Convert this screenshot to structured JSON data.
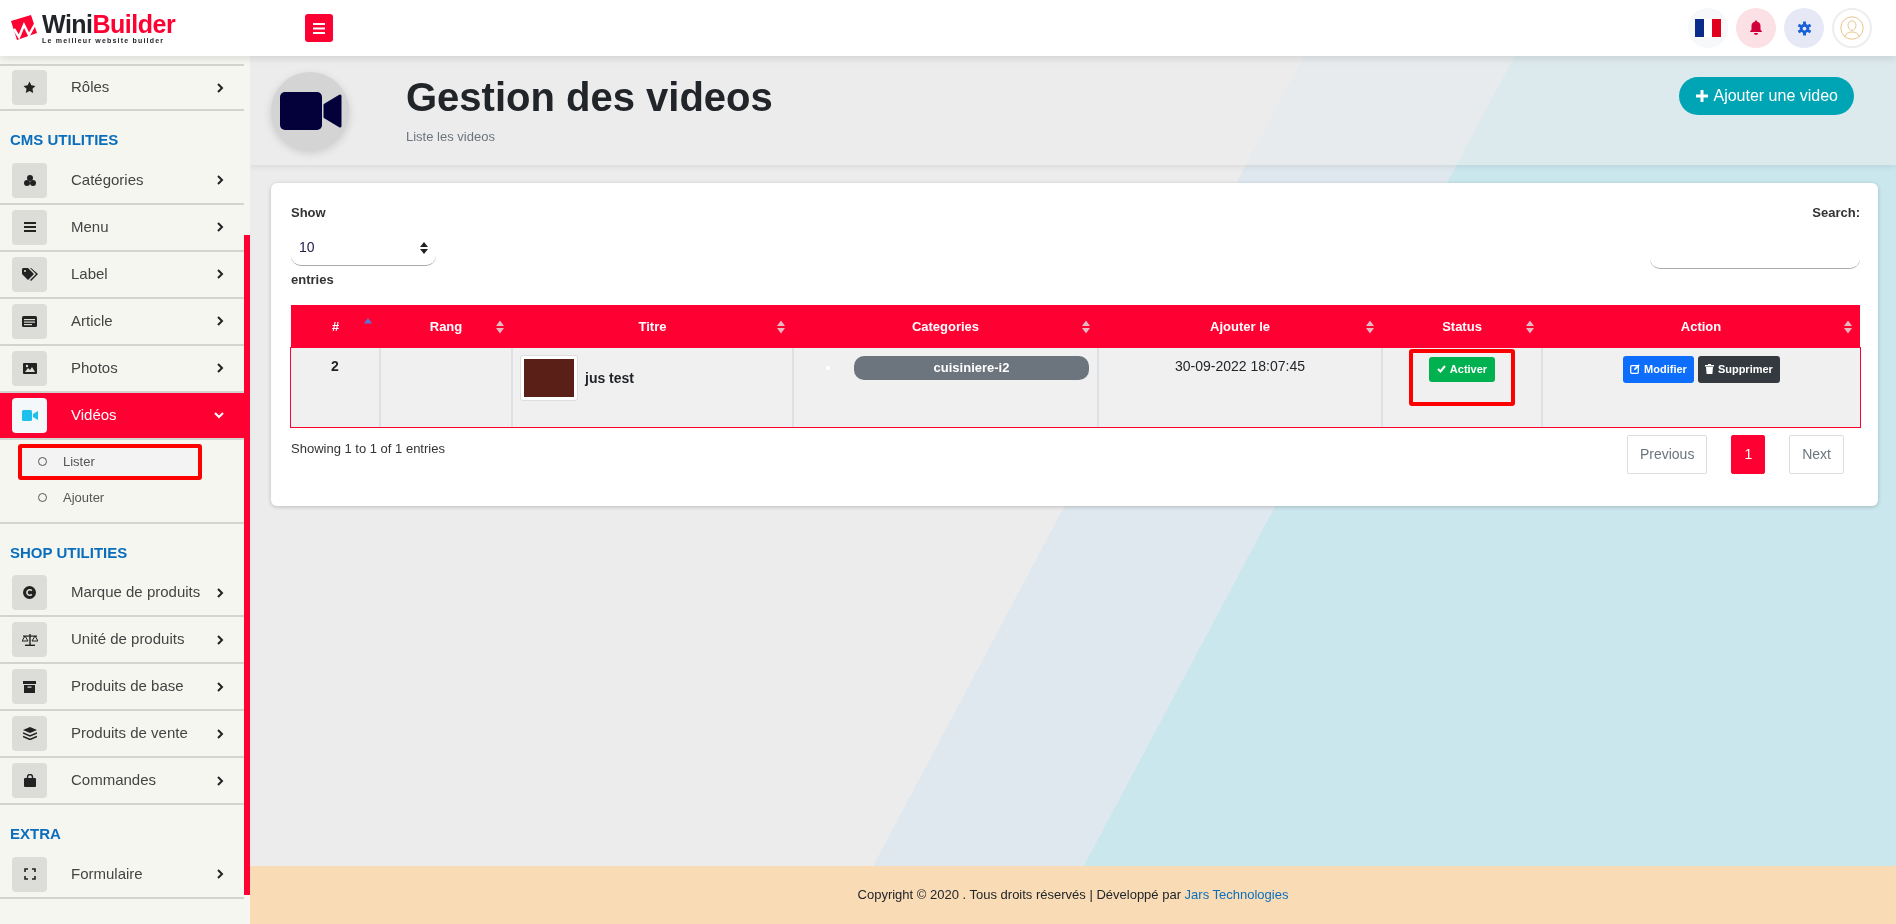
{
  "header": {
    "logo": {
      "primary": "Wini",
      "accent": "Builder",
      "tagline": "Le meilleur website builder"
    }
  },
  "sidebar": {
    "sections": [
      {
        "items": [
          {
            "label": "Rôles",
            "selected": false,
            "expanded": false
          }
        ]
      },
      {
        "heading": "CMS UTILITIES",
        "items": [
          {
            "label": "Catégories",
            "selected": false,
            "expanded": false
          },
          {
            "label": "Menu",
            "selected": false,
            "expanded": false
          },
          {
            "label": "Label",
            "selected": false,
            "expanded": false
          },
          {
            "label": "Article",
            "selected": false,
            "expanded": false
          },
          {
            "label": "Photos",
            "selected": false,
            "expanded": false
          },
          {
            "label": "Vidéos",
            "selected": true,
            "expanded": true,
            "children": [
              {
                "label": "Lister",
                "annotated": true
              },
              {
                "label": "Ajouter",
                "annotated": false
              }
            ]
          }
        ]
      },
      {
        "heading": "SHOP UTILITIES",
        "items": [
          {
            "label": "Marque de produits",
            "selected": false,
            "expanded": false
          },
          {
            "label": "Unité de produits",
            "selected": false,
            "expanded": false
          },
          {
            "label": "Produits de base",
            "selected": false,
            "expanded": false
          },
          {
            "label": "Produits de vente",
            "selected": false,
            "expanded": false
          },
          {
            "label": "Commandes",
            "selected": false,
            "expanded": false
          }
        ]
      },
      {
        "heading": "EXTRA",
        "items": [
          {
            "label": "Formulaire",
            "selected": false,
            "expanded": false
          }
        ]
      }
    ]
  },
  "page_header": {
    "title": "Gestion des videos",
    "subtitle": "Liste les videos",
    "add_button": "Ajouter une video"
  },
  "table_controls": {
    "show_label": "Show",
    "page_length": "10",
    "entries_label": "entries",
    "search_label": "Search:"
  },
  "table": {
    "columns": [
      {
        "label": "#",
        "sorted": true
      },
      {
        "label": "Rang",
        "sorted": false
      },
      {
        "label": "Titre",
        "sorted": false
      },
      {
        "label": "Categories",
        "sorted": false
      },
      {
        "label": "Ajouter le",
        "sorted": false
      },
      {
        "label": "Status",
        "sorted": false
      },
      {
        "label": "Action",
        "sorted": false
      }
    ],
    "rows": [
      {
        "number": "2",
        "title": "jus test",
        "categories": [
          "cuisiniere-i2"
        ],
        "added": "30-09-2022 18:07:45",
        "status": {
          "label": "Activer",
          "active": true,
          "annotated": true
        },
        "actions": [
          {
            "kind": "edit",
            "label": "Modifier"
          },
          {
            "kind": "delete",
            "label": "Supprimer"
          }
        ]
      }
    ]
  },
  "table_info": "Showing 1 to 1 of 1 entries",
  "pagination": [
    {
      "label": "Previous",
      "disabled": true,
      "selected": false
    },
    {
      "label": "1",
      "disabled": false,
      "selected": true
    },
    {
      "label": "Next",
      "disabled": true,
      "selected": false
    }
  ],
  "footer": {
    "text": "Copyright © 2020 . Tous droits réservés | Développé par",
    "link": "Jars Technologies"
  }
}
